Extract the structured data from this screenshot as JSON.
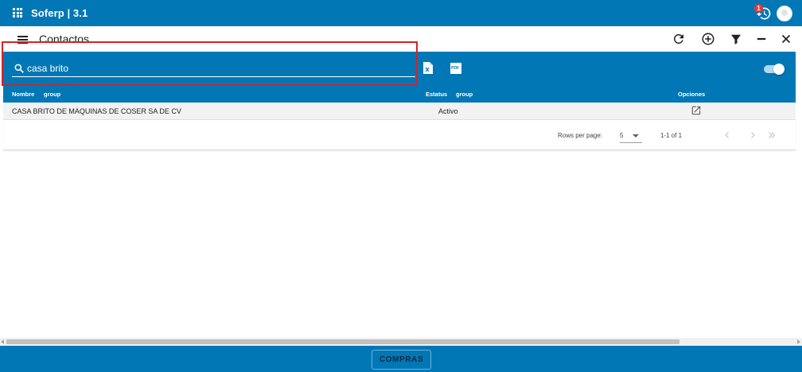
{
  "app": {
    "title": "Soferp | 3.1",
    "notification_count": "1",
    "brand_color": "#0277b6"
  },
  "header": {
    "page_title": "Contactos",
    "icons": [
      "refresh-icon",
      "add-circle-icon",
      "filter-icon",
      "minimize-icon",
      "close-icon"
    ]
  },
  "search": {
    "value": "casa brito",
    "placeholder": ""
  },
  "export": {
    "excel_icon": "excel-export-icon",
    "pdf_icon": "pdf-export-icon",
    "pdf_label": "PDF"
  },
  "table": {
    "columns": [
      {
        "label": "Nombre",
        "group": "group"
      },
      {
        "label": "Estatus",
        "group": "group"
      },
      {
        "label": "Opciones"
      }
    ],
    "rows": [
      {
        "nombre": "CASA BRITO DE MAQUINAS DE COSER SA DE CV",
        "estatus": "Activo"
      }
    ]
  },
  "pagination": {
    "rows_per_page_label": "Rows per page:",
    "rows_per_page_value": "5",
    "range": "1-1 of 1"
  },
  "footer": {
    "compras_label": "COMPRAS"
  }
}
